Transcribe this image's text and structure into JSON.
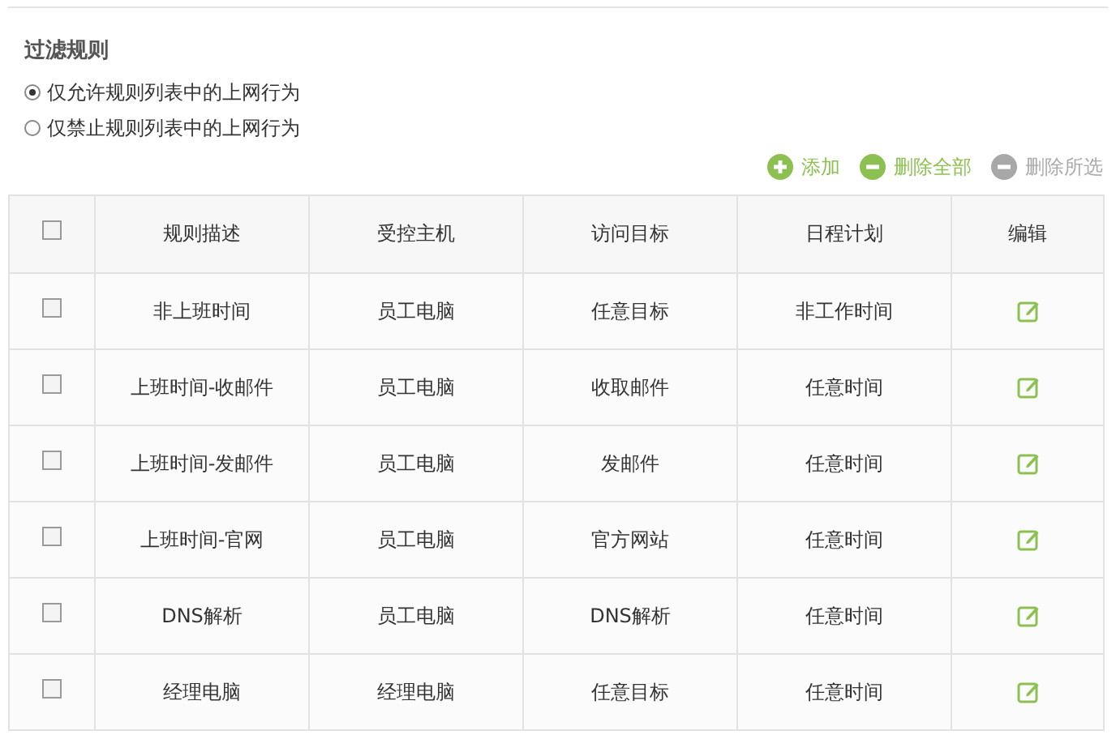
{
  "section_title": "过滤规则",
  "modes": [
    {
      "label": "仅允许规则列表中的上网行为",
      "selected": true
    },
    {
      "label": "仅禁止规则列表中的上网行为",
      "selected": false
    }
  ],
  "toolbar": [
    {
      "kind": "add",
      "label": "添加",
      "disabled": false
    },
    {
      "kind": "remove",
      "label": "删除全部",
      "disabled": false
    },
    {
      "kind": "remove",
      "label": "删除所选",
      "disabled": true
    }
  ],
  "table": {
    "select_all_checked": false,
    "columns": [
      "规则描述",
      "受控主机",
      "访问目标",
      "日程计划",
      "编辑"
    ],
    "rows": [
      {
        "checked": false,
        "cells": [
          "非上班时间",
          "员工电脑",
          "任意目标",
          "非工作时间"
        ]
      },
      {
        "checked": false,
        "cells": [
          "上班时间-收邮件",
          "员工电脑",
          "收取邮件",
          "任意时间"
        ]
      },
      {
        "checked": false,
        "cells": [
          "上班时间-发邮件",
          "员工电脑",
          "发邮件",
          "任意时间"
        ]
      },
      {
        "checked": false,
        "cells": [
          "上班时间-官网",
          "员工电脑",
          "官方网站",
          "任意时间"
        ]
      },
      {
        "checked": false,
        "cells": [
          "DNS解析",
          "员工电脑",
          "DNS解析",
          "任意时间"
        ]
      },
      {
        "checked": false,
        "cells": [
          "经理电脑",
          "经理电脑",
          "任意目标",
          "任意时间"
        ]
      }
    ]
  }
}
